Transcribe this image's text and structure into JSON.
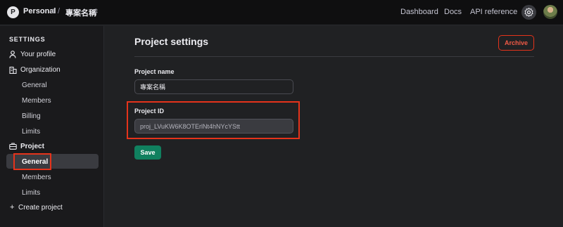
{
  "topbar": {
    "org_initial": "P",
    "org_name": "Personal",
    "separator": "/",
    "project_name": "專案名稱",
    "nav": [
      "Dashboard",
      "Docs",
      "API reference"
    ]
  },
  "sidebar": {
    "heading": "SETTINGS",
    "your_profile": "Your profile",
    "organization": {
      "label": "Organization",
      "items": [
        "General",
        "Members",
        "Billing",
        "Limits"
      ]
    },
    "project": {
      "label": "Project",
      "items": [
        "General",
        "Members",
        "Limits"
      ],
      "active": "General"
    },
    "create_project": "Create project"
  },
  "main": {
    "title": "Project settings",
    "archive_label": "Archive",
    "project_name_label": "Project name",
    "project_name_value": "專案名稱",
    "project_id_label": "Project ID",
    "project_id_value": "proj_LVuKW6K8OTErlNt4hNYcYStt",
    "save_label": "Save"
  },
  "colors": {
    "accent_green": "#10805f",
    "danger_red": "#e5331b",
    "annotation_red": "#e5331b"
  },
  "icons": [
    "user-icon",
    "building-icon",
    "briefcase-icon",
    "plus-icon",
    "gear-icon",
    "chevron-updown-icon"
  ]
}
